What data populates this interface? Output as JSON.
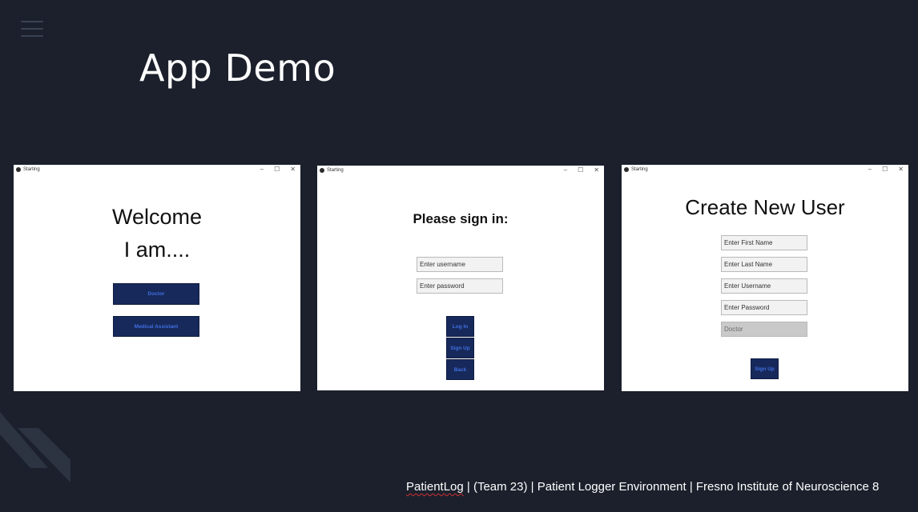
{
  "slide": {
    "title": "App Demo",
    "footer": {
      "brand": "PatientLog",
      "rest": " | (Team 23) | Patient Logger Environment | Fresno Institute of Neuroscience 8"
    }
  },
  "window": {
    "title": "Starting",
    "controls": {
      "minimize": "–",
      "maximize": "☐",
      "close": "✕"
    }
  },
  "screen1": {
    "heading1": "Welcome",
    "heading2": "I am....",
    "doctor_button": "Doctor",
    "assistant_button": "Medical Assistant"
  },
  "screen2": {
    "heading": "Please sign in:",
    "username_placeholder": "Enter username",
    "password_placeholder": "Enter password",
    "login_button": "Log In",
    "signup_button": "Sign Up",
    "back_button": "Back"
  },
  "screen3": {
    "heading": "Create New User",
    "first_name_placeholder": "Enter First Name",
    "last_name_placeholder": "Enter Last Name",
    "username_placeholder": "Enter Username",
    "password_placeholder": "Enter Password",
    "role_value": "Doctor",
    "signup_button": "Sign Up"
  },
  "colors": {
    "background": "#1b202c",
    "button": "#17295b",
    "button_text": "#3f6ee0"
  }
}
